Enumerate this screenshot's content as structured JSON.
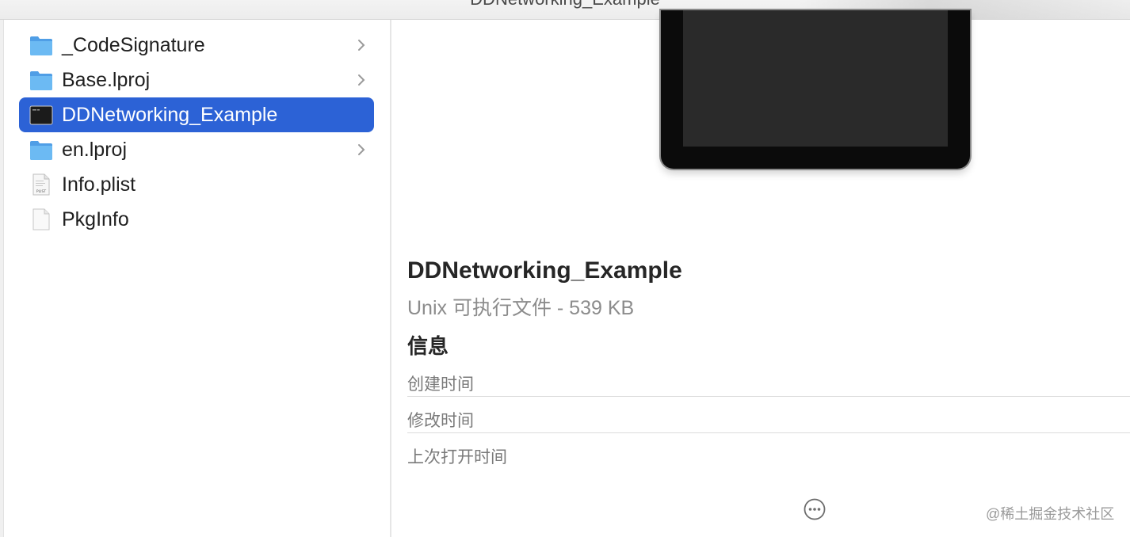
{
  "window": {
    "title": "DDNetworking_Example"
  },
  "files": [
    {
      "label": "_CodeSignature",
      "icon": "folder-icon",
      "has_chevron": true,
      "selected": false
    },
    {
      "label": "Base.lproj",
      "icon": "folder-icon",
      "has_chevron": true,
      "selected": false
    },
    {
      "label": "DDNetworking_Example",
      "icon": "terminal-exec-icon",
      "has_chevron": false,
      "selected": true
    },
    {
      "label": "en.lproj",
      "icon": "folder-icon",
      "has_chevron": true,
      "selected": false
    },
    {
      "label": "Info.plist",
      "icon": "plist-document-icon",
      "has_chevron": false,
      "selected": false
    },
    {
      "label": "PkgInfo",
      "icon": "blank-document-icon",
      "has_chevron": false,
      "selected": false
    }
  ],
  "preview": {
    "name": "DDNetworking_Example",
    "kind": "Unix 可执行文件 - 539 KB",
    "info_heading": "信息",
    "info_rows": [
      {
        "label": "创建时间"
      },
      {
        "label": "修改时间"
      },
      {
        "label": "上次打开时间"
      }
    ],
    "more_icon": "ellipsis-circle-icon"
  },
  "icon_glyphs": {
    "plist_tag": "PLIST"
  },
  "watermark": "@稀土掘金技术社区",
  "colors": {
    "selection": "#2c62d6",
    "folder": "#5fb2f0",
    "secondary_text": "#8c8c8c"
  }
}
